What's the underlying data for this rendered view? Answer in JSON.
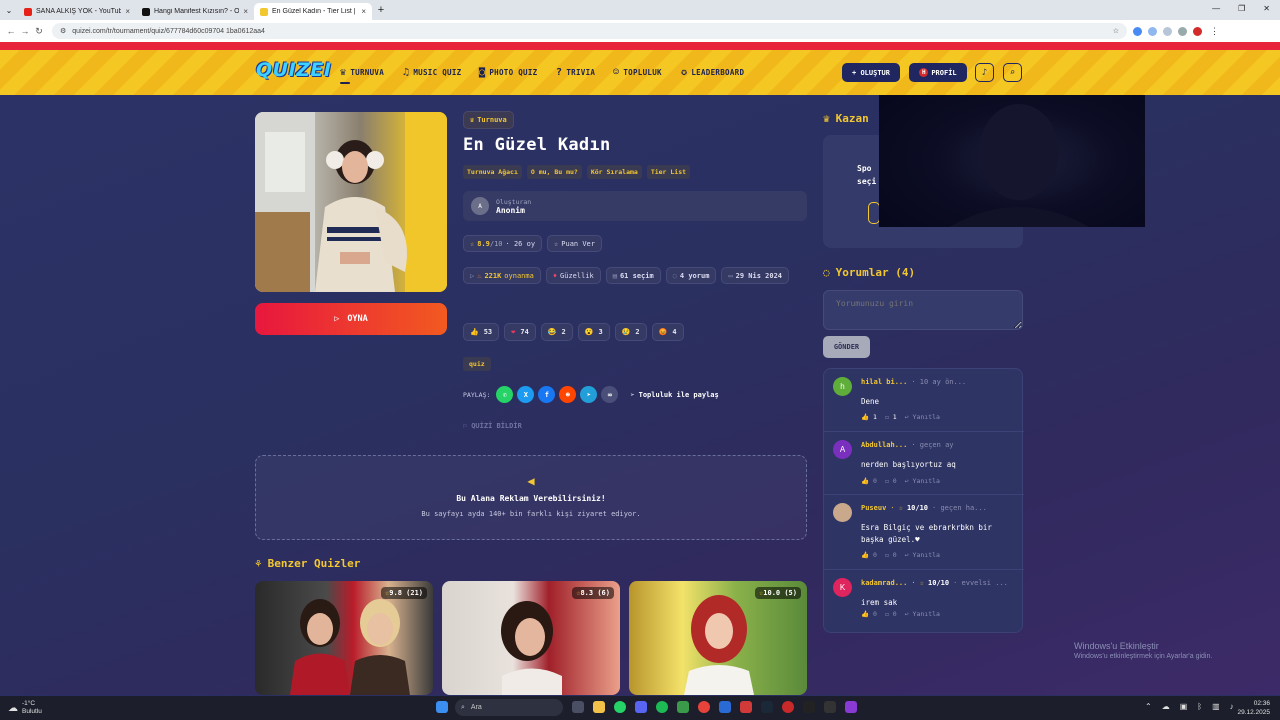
{
  "browser": {
    "tabs": [
      {
        "title": "SANA ALKIŞ YOK - YouTube",
        "favicon_color": "#e62117"
      },
      {
        "title": "Hangi Manifest Kızısın? - Onedi...",
        "favicon_color": "#111111"
      },
      {
        "title": "En Güzel Kadın - Tier List | Kör...",
        "favicon_color": "#f3c730"
      }
    ],
    "url": "quizei.com/tr/tournament/quiz/677784d60c09704 1ba0612aa4"
  },
  "site": {
    "logo": "QUIZEI",
    "nav": [
      {
        "label": "TURNUVA",
        "icon": "trophy-icon",
        "glyph": "♛"
      },
      {
        "label": "MUSIC QUIZ",
        "icon": "music-icon",
        "glyph": "♫"
      },
      {
        "label": "PHOTO QUIZ",
        "icon": "camera-icon",
        "glyph": "◙"
      },
      {
        "label": "TRIVIA",
        "icon": "question-icon",
        "glyph": "?"
      },
      {
        "label": "TOPLULUK",
        "icon": "users-icon",
        "glyph": "☺"
      },
      {
        "label": "LEADERBOARD",
        "icon": "medal-icon",
        "glyph": "✪"
      }
    ],
    "create_label": "+ OLUŞTUR",
    "profile_label": "PROFİL",
    "profile_initial": "H"
  },
  "quiz": {
    "type_badge": "Turnuva",
    "title": "En Güzel Kadın",
    "modes": [
      "Turnuva Ağacı",
      "O mu, Bu mu?",
      "Kör Sıralama",
      "Tier List"
    ],
    "creator_label": "Oluşturan",
    "creator_name": "Anonim",
    "creator_initial": "A",
    "rating": "8.9",
    "rating_max": "/10",
    "rating_count": "· 26 oy",
    "rate_label": "Puan Ver",
    "plays": "221K",
    "plays_label": "oynanma",
    "category": "Güzellik",
    "choices": "61 seçim",
    "comments_count": "4 yorum",
    "date": "29 Nis 2024",
    "play_label": "OYNA",
    "reactions": [
      {
        "emoji": "👍",
        "count": "53"
      },
      {
        "emoji": "❤",
        "count": "74"
      },
      {
        "emoji": "😂",
        "count": "2"
      },
      {
        "emoji": "😮",
        "count": "3"
      },
      {
        "emoji": "😢",
        "count": "2"
      },
      {
        "emoji": "😡",
        "count": "4"
      }
    ],
    "tag": "quiz",
    "share_label": "PAYLAŞ:",
    "community_share": "Topluluk ile paylaş",
    "report_label": "QUİZİ BİLDİR"
  },
  "ad": {
    "title": "Bu Alana Reklam Verebilirsiniz!",
    "subtitle": "Bu sayfayı ayda 140+ bin farklı kişi ziyaret ediyor."
  },
  "similar": {
    "title": "Benzer Quizler",
    "items": [
      {
        "rating": "9.8",
        "count": "(21)"
      },
      {
        "rating": "8.3",
        "count": "(6)"
      },
      {
        "rating": "10.0",
        "count": "(5)"
      }
    ]
  },
  "winners": {
    "title": "Kazan",
    "text_line1": "Spo",
    "text_line2": "seçi"
  },
  "comments": {
    "title": "Yorumlar (4)",
    "placeholder": "Yorumunuzu girin",
    "send_label": "GÖNDER",
    "reply_label": "Yanıtla",
    "items": [
      {
        "initial": "h",
        "color": "#5fae3a",
        "name": "hilal bi...",
        "rating": "",
        "date": "· 10 ay ön...",
        "text": "Dene",
        "likes": "1",
        "replies": "1"
      },
      {
        "initial": "A",
        "color": "#7b2fbe",
        "name": "Abdullah...",
        "rating": "",
        "date": "· geçen ay",
        "text": "nerden başlıyortuz aq",
        "likes": "0",
        "replies": "0"
      },
      {
        "initial": "",
        "color": "#c9a88c",
        "name": "Puseuv",
        "rating": "10/10",
        "date": "· geçen ha...",
        "text": "Esra Bilgiç ve ebrarkrbkn bir başka güzel.♥",
        "likes": "0",
        "replies": "0"
      },
      {
        "initial": "K",
        "color": "#e0245e",
        "name": "kadamrad...",
        "rating": "10/10",
        "date": "· evvelsi ...",
        "text": "irem sak",
        "likes": "0",
        "replies": "0"
      }
    ]
  },
  "windows": {
    "watermark_title": "Windows'u Etkinleştir",
    "watermark_sub": "Windows'u etkinleştirmek için Ayarlar'a gidin.",
    "weather_temp": "-1°C",
    "weather_desc": "Bulutlu",
    "search_placeholder": "Ara",
    "time": "02:36",
    "date": "29.12.2025"
  }
}
